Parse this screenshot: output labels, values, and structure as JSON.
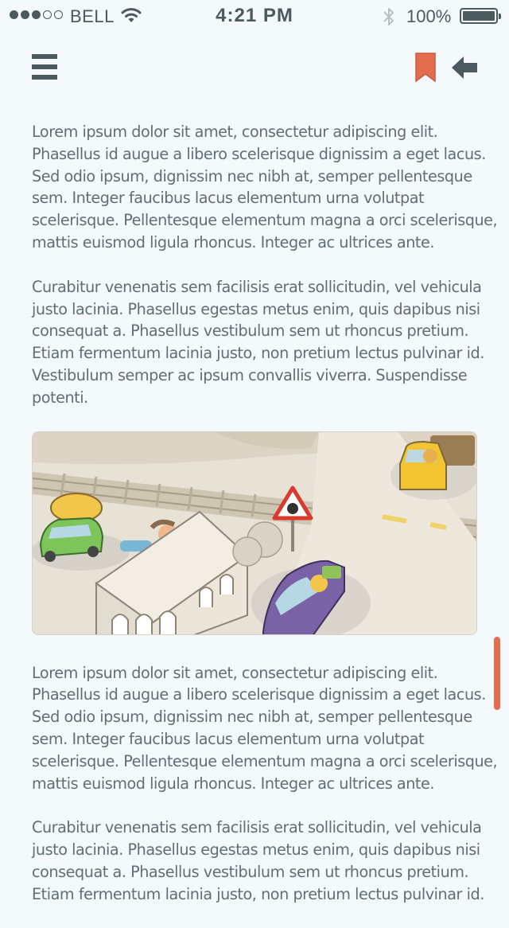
{
  "status_bar": {
    "carrier": "BELL",
    "time": "4:21 PM",
    "battery_percent": "100%",
    "signal_bars_filled": 3,
    "signal_bars_total": 5
  },
  "nav": {
    "menu_icon": "hamburger-menu-icon",
    "bookmark_icon": "bookmark-icon",
    "back_icon": "back-arrow-icon",
    "bookmark_color": "#e36d4c",
    "icon_color": "#4a5a5f"
  },
  "article": {
    "block1": {
      "p1": [
        "Lorem ipsum dolor sit amet, consectetur adipiscing elit.",
        "Phasellus id augue a libero scelerisque dignissim a eget lacus.",
        "Sed odio ipsum, dignissim nec nibh at, semper pellentesque",
        "sem. Integer faucibus lacus elementum urna volutpat",
        "scelerisque. Pellentesque elementum magna a orci scelerisque,",
        "mattis euismod ligula rhoncus. Integer ac ultrices ante."
      ],
      "p2": [
        "Curabitur venenatis sem facilisis erat sollicitudin, vel vehicula",
        "justo lacinia. Phasellus egestas metus enim, quis dapibus nisi",
        "consequat a. Phasellus vestibulum sem ut rhoncus pretium.",
        "Etiam fermentum lacinia justo, non pretium lectus pulvinar id.",
        "Vestibulum semper ac ipsum convallis viverra. Suspendisse",
        "potenti."
      ]
    },
    "illustration_alt": "illustration-railroad-crossing-cars",
    "block2": {
      "p1": [
        "Lorem ipsum dolor sit amet, consectetur adipiscing elit.",
        "Phasellus id augue a libero scelerisque dignissim a eget lacus.",
        "Sed odio ipsum, dignissim nec nibh at, semper pellentesque",
        "sem. Integer faucibus lacus elementum urna volutpat",
        "scelerisque. Pellentesque elementum magna a orci scelerisque,",
        "mattis euismod ligula rhoncus. Integer ac ultrices ante."
      ],
      "p2": [
        "Curabitur venenatis sem facilisis erat sollicitudin, vel vehicula",
        "justo lacinia. Phasellus egestas metus enim, quis dapibus nisi",
        "consequat a. Phasellus vestibulum sem ut rhoncus pretium.",
        "Etiam fermentum lacinia justo, non pretium lectus pulvinar id."
      ]
    }
  },
  "scroll_indicator_color": "#e36d4c"
}
